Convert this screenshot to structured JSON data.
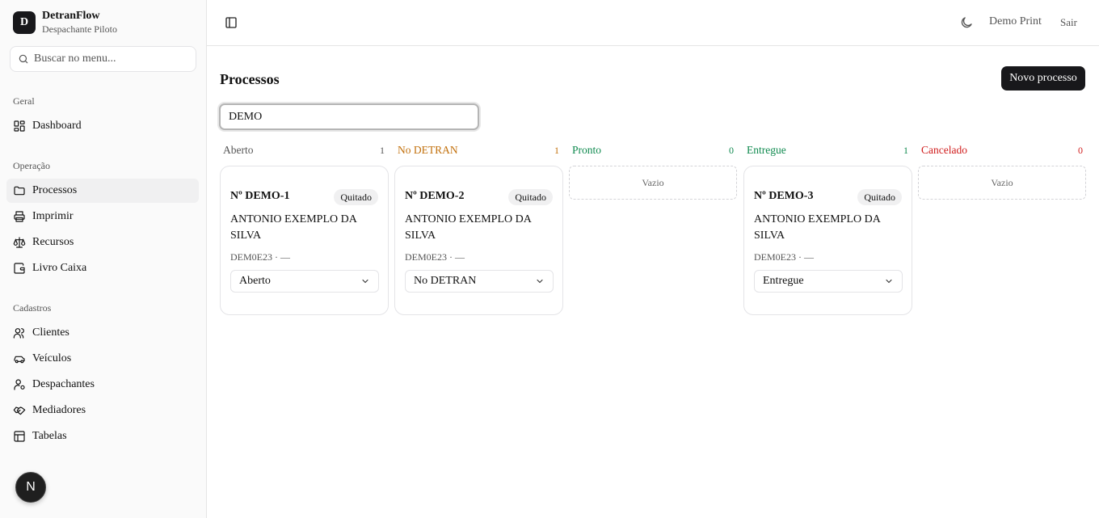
{
  "brand": {
    "initial": "D",
    "name": "DetranFlow",
    "subtitle": "Despachante Piloto"
  },
  "sidebar": {
    "search_placeholder": "Buscar no menu...",
    "groups": [
      {
        "label": "Geral",
        "items": [
          {
            "label": "Dashboard",
            "icon": "dashboard-icon"
          }
        ]
      },
      {
        "label": "Operação",
        "items": [
          {
            "label": "Processos",
            "icon": "folder-icon",
            "active": true
          },
          {
            "label": "Imprimir",
            "icon": "printer-icon"
          },
          {
            "label": "Recursos",
            "icon": "scale-icon"
          },
          {
            "label": "Livro Caixa",
            "icon": "wallet-icon"
          }
        ]
      },
      {
        "label": "Cadastros",
        "items": [
          {
            "label": "Clientes",
            "icon": "users-icon"
          },
          {
            "label": "Veículos",
            "icon": "car-icon"
          },
          {
            "label": "Despachantes",
            "icon": "user-key-icon"
          },
          {
            "label": "Mediadores",
            "icon": "handshake-icon"
          },
          {
            "label": "Tabelas",
            "icon": "table-icon"
          }
        ]
      }
    ],
    "badge": "N"
  },
  "header": {
    "user": "Demo Print",
    "logout": "Sair"
  },
  "main": {
    "title": "Processos",
    "new_button": "Novo processo",
    "filter_value": "DEMO",
    "empty_label": "Vazio",
    "columns": [
      {
        "label": "Aberto",
        "count": "1",
        "color": "#555555"
      },
      {
        "label": "No DETRAN",
        "count": "1",
        "color": "#c2700c"
      },
      {
        "label": "Pronto",
        "count": "0",
        "color": "#0f8a4f"
      },
      {
        "label": "Entregue",
        "count": "1",
        "color": "#0f8a4f"
      },
      {
        "label": "Cancelado",
        "count": "0",
        "color": "#d01c1c"
      }
    ],
    "cards": [
      {
        "title": "Nº DEMO-1",
        "badge": "Quitado",
        "name": "ANTONIO EXEMPLO DA SILVA",
        "meta": "DEM0E23 · —",
        "status": "Aberto"
      },
      {
        "title": "Nº DEMO-2",
        "badge": "Quitado",
        "name": "ANTONIO EXEMPLO DA SILVA",
        "meta": "DEM0E23 · —",
        "status": "No DETRAN"
      },
      {
        "title": "Nº DEMO-3",
        "badge": "Quitado",
        "name": "ANTONIO EXEMPLO DA SILVA",
        "meta": "DEM0E23 · —",
        "status": "Entregue"
      }
    ]
  }
}
